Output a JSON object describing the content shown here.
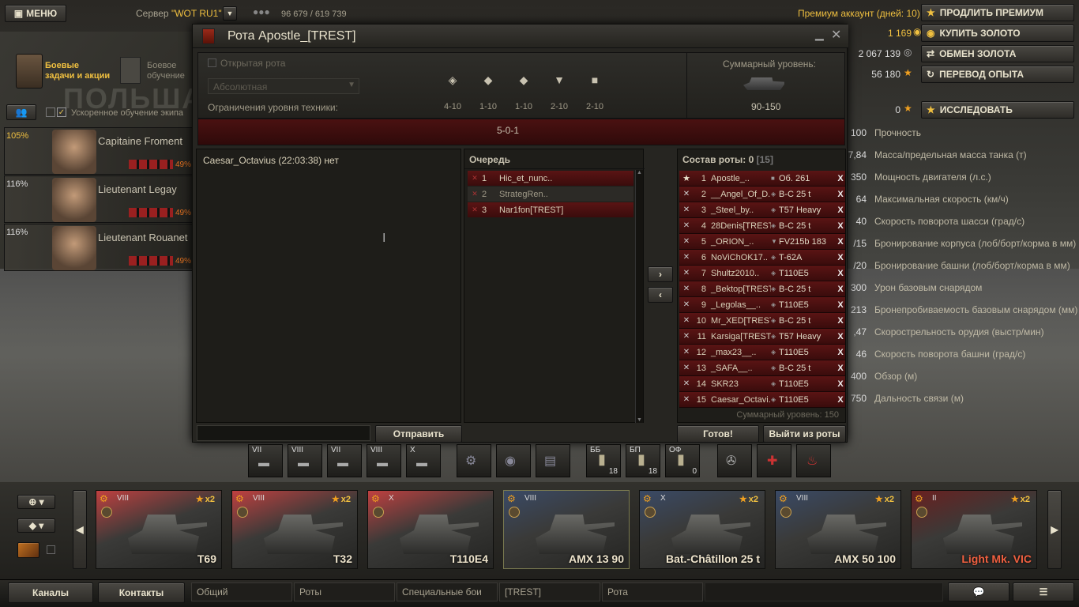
{
  "top": {
    "menu_label": "МЕНЮ",
    "server_label": "Сервер",
    "server_name": "\"WOT RU1\"",
    "online": "96 679 / 619 739",
    "premium_text": "Премиум аккаунт (дней: 10)",
    "extend_premium": "ПРОДЛИТЬ ПРЕМИУМ",
    "gold": "1 169",
    "buy_gold": "КУПИТЬ ЗОЛОТО",
    "credits": "2 067 139",
    "exchange_gold": "ОБМЕН ЗОЛОТА",
    "free_xp": "56 180",
    "convert_xp": "ПЕРЕВОД ОПЫТА",
    "research_xp": "0",
    "research": "ИССЛЕДОВАТЬ",
    "battle_tasks": "Боевые\nзадачи и акции",
    "training": "Боевое\nобучение",
    "accelerated_crew": "Ускоренное обучение экипа",
    "banner_text": "ПОЛЬША"
  },
  "crew": [
    {
      "percent": "105%",
      "name": "Capitaine Froment",
      "skill": "49%"
    },
    {
      "percent": "116%",
      "name": "Lieutenant Legay",
      "skill": "49%"
    },
    {
      "percent": "116%",
      "name": "Lieutenant Rouanet",
      "skill": "49%"
    }
  ],
  "window": {
    "title": "Рота Apostle_[TREST]",
    "open_company": "Открытая рота",
    "division_select": "Абсолютная",
    "level_limits_label": "Ограничения уровня техники:",
    "total_level_label": "Суммарный уровень:",
    "classes": [
      {
        "icon": "heavy-tank-icon",
        "range": "4-10"
      },
      {
        "icon": "medium-tank-icon",
        "range": "1-10"
      },
      {
        "icon": "light-tank-icon",
        "range": "1-10"
      },
      {
        "icon": "td-icon",
        "range": "2-10"
      },
      {
        "icon": "spg-icon",
        "range": "2-10"
      }
    ],
    "total_range": "90-150",
    "composition": "5-0-1",
    "chat_message": "Caesar_Octavius (22:03:38) нет",
    "queue_title": "Очередь",
    "queue": [
      {
        "num": "1",
        "name": "Hic_et_nunc.."
      },
      {
        "num": "2",
        "name": "StrategRen.."
      },
      {
        "num": "3",
        "name": "Nar1fon[TREST]"
      }
    ],
    "roster_title": "Состав роты:",
    "roster_count": "0",
    "roster_max": "[15]",
    "roster": [
      {
        "num": "1",
        "name": "Apostle_..",
        "tank": "Об. 261"
      },
      {
        "num": "2",
        "name": "__Angel_Of_D..",
        "tank": "B-C 25 t"
      },
      {
        "num": "3",
        "name": "_Steel_by..",
        "tank": "T57 Heavy"
      },
      {
        "num": "4",
        "name": "28Denis[TREST]",
        "tank": "B-C 25 t"
      },
      {
        "num": "5",
        "name": "_ORION_..",
        "tank": "FV215b 183"
      },
      {
        "num": "6",
        "name": "NoViChOK17..",
        "tank": "T-62A"
      },
      {
        "num": "7",
        "name": "Shultz2010..",
        "tank": "T110E5"
      },
      {
        "num": "8",
        "name": "_Bektop[TREST]",
        "tank": "B-C 25 t"
      },
      {
        "num": "9",
        "name": "_Legolas__..",
        "tank": "T110E5"
      },
      {
        "num": "10",
        "name": "Mr_XED[TREST]",
        "tank": "B-C 25 t"
      },
      {
        "num": "11",
        "name": "Karsiga[TREST]",
        "tank": "T57 Heavy"
      },
      {
        "num": "12",
        "name": "_max23__..",
        "tank": "T110E5"
      },
      {
        "num": "13",
        "name": "_SAFA__..",
        "tank": "B-C 25 t"
      },
      {
        "num": "14",
        "name": "SKR23",
        "tank": "T110E5"
      },
      {
        "num": "15",
        "name": "Caesar_Octavi..",
        "tank": "T110E5"
      }
    ],
    "roster_total": "Суммарный уровень: 150",
    "send": "Отправить",
    "ready": "Готов!",
    "leave": "Выйти из роты",
    "kick": "X"
  },
  "stats": [
    {
      "value": "100",
      "label": "Прочность"
    },
    {
      "value": "7,84",
      "label": "Масса/предельная масса танка (т)"
    },
    {
      "value": "350",
      "label": "Мощность двигателя (л.с.)"
    },
    {
      "value": "64",
      "label": "Максимальная скорость (км/ч)"
    },
    {
      "value": "40",
      "label": "Скорость поворота шасси (град/с)"
    },
    {
      "value": "/15",
      "label": "Бронирование корпуса (лоб/борт/корма в мм)"
    },
    {
      "value": "/20",
      "label": "Бронирование башни (лоб/борт/корма в мм)"
    },
    {
      "value": "300",
      "label": "Урон базовым снарядом"
    },
    {
      "value": "213",
      "label": "Бронепробиваемость базовым снарядом (мм)"
    },
    {
      "value": ",47",
      "label": "Скорострельность орудия (выстр/мин)"
    },
    {
      "value": "46",
      "label": "Скорость поворота башни (град/с)"
    },
    {
      "value": "400",
      "label": "Обзор (м)"
    },
    {
      "value": "750",
      "label": "Дальность связи (м)"
    }
  ],
  "slots": [
    {
      "tier": "VII",
      "count": ""
    },
    {
      "tier": "VIII",
      "count": ""
    },
    {
      "tier": "VII",
      "count": ""
    },
    {
      "tier": "VIII",
      "count": ""
    },
    {
      "tier": "X",
      "count": ""
    }
  ],
  "ammo": [
    {
      "type": "ББ",
      "count": "18"
    },
    {
      "type": "БП",
      "count": "18"
    },
    {
      "type": "ОФ",
      "count": "0"
    }
  ],
  "vehicles": [
    {
      "tier": "VIII",
      "name": "T69",
      "x2": "x2",
      "accent": "#c04040"
    },
    {
      "tier": "VIII",
      "name": "T32",
      "x2": "x2",
      "accent": "#c04040"
    },
    {
      "tier": "X",
      "name": "T110E4",
      "x2": "",
      "accent": "#c04040"
    },
    {
      "tier": "VIII",
      "name": "AMX 13 90",
      "x2": "",
      "accent": "#3a4a66"
    },
    {
      "tier": "X",
      "name": "Bat.-Châtillon 25 t",
      "x2": "x2",
      "accent": "#3a4a66"
    },
    {
      "tier": "VIII",
      "name": "AMX 50 100",
      "x2": "x2",
      "accent": "#3a4a66"
    },
    {
      "tier": "II",
      "name": "Light Mk. VIC",
      "x2": "x2",
      "accent": "#6a2020"
    }
  ],
  "channels": {
    "channels": "Каналы",
    "contacts": "Контакты",
    "tabs": [
      "Общий",
      "Роты",
      "Специальные бои",
      "[TREST]",
      "Рота"
    ]
  }
}
